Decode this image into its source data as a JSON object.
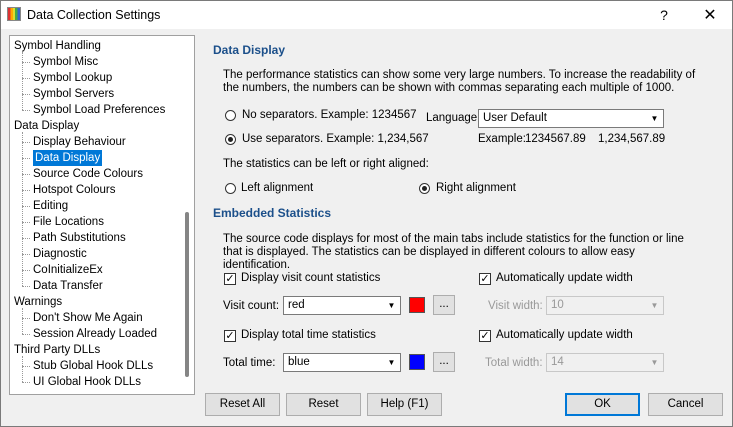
{
  "window": {
    "title": "Data Collection Settings",
    "help_glyph": "?",
    "close_glyph": "✕"
  },
  "tree": {
    "items": [
      {
        "label": "Symbol Handling",
        "level": 0
      },
      {
        "label": "Symbol Misc",
        "level": 1
      },
      {
        "label": "Symbol Lookup",
        "level": 1
      },
      {
        "label": "Symbol Servers",
        "level": 1
      },
      {
        "label": "Symbol Load Preferences",
        "level": 1
      },
      {
        "label": "Data Display",
        "level": 0
      },
      {
        "label": "Display Behaviour",
        "level": 1
      },
      {
        "label": "Data Display",
        "level": 1,
        "selected": true
      },
      {
        "label": "Source Code Colours",
        "level": 1
      },
      {
        "label": "Hotspot Colours",
        "level": 1
      },
      {
        "label": "Editing",
        "level": 1
      },
      {
        "label": "File Locations",
        "level": 1
      },
      {
        "label": "Path Substitutions",
        "level": 1
      },
      {
        "label": "Diagnostic",
        "level": 1
      },
      {
        "label": "CoInitializeEx",
        "level": 1
      },
      {
        "label": "Data Transfer",
        "level": 1
      },
      {
        "label": "Warnings",
        "level": 0
      },
      {
        "label": "Don't Show Me Again",
        "level": 1
      },
      {
        "label": "Session Already Loaded",
        "level": 1
      },
      {
        "label": "Third Party DLLs",
        "level": 0
      },
      {
        "label": "Stub Global Hook DLLs",
        "level": 1
      },
      {
        "label": "UI Global Hook DLLs",
        "level": 1
      }
    ]
  },
  "data_display": {
    "heading": "Data Display",
    "description": "The performance statistics can show some very large numbers. To increase the readability of the numbers, the numbers can be shown with commas separating each multiple of 1000.",
    "no_sep_label": "No separators. Example: 1234567",
    "use_sep_label": "Use separators. Example: 1,234,567",
    "language_label": "Language:",
    "language_value": "User Default",
    "example_label": "Example:",
    "example_plain": "1234567.89",
    "example_sep": "1,234,567.89",
    "align_text": "The statistics can be left or right aligned:",
    "left_align_label": "Left alignment",
    "right_align_label": "Right alignment"
  },
  "embedded": {
    "heading": "Embedded Statistics",
    "description": "The source code displays for most of the main tabs include statistics for the function or line that is displayed. The statistics can be displayed in different colours to allow easy identification.",
    "visit_check_label": "Display visit count statistics",
    "visit_count_label": "Visit count:",
    "visit_count_value": "red",
    "visit_color": "#ff0000",
    "auto_update_label": "Automatically update width",
    "visit_width_label": "Visit width:",
    "visit_width_value": "10",
    "total_check_label": "Display total time statistics",
    "total_time_label": "Total time:",
    "total_time_value": "blue",
    "total_color": "#0000ff",
    "total_width_label": "Total width:",
    "total_width_value": "14",
    "ellipsis": "..."
  },
  "buttons": {
    "reset_all": "Reset All",
    "reset": "Reset",
    "help": "Help (F1)",
    "ok": "OK",
    "cancel": "Cancel"
  },
  "glyphs": {
    "check": "✓",
    "dropdown": "▼"
  }
}
